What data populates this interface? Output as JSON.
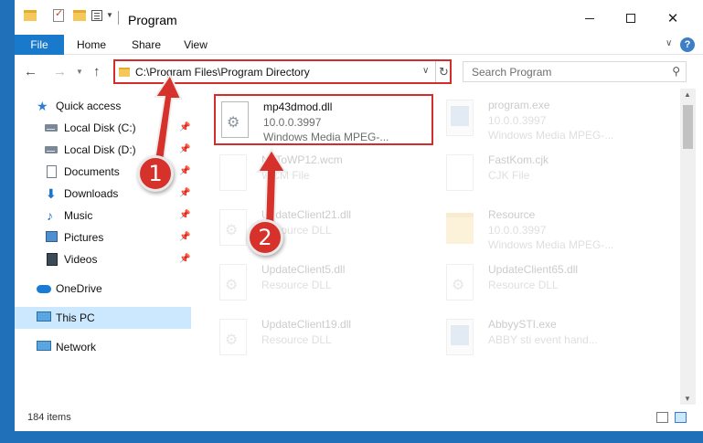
{
  "window": {
    "title": "Program"
  },
  "ribbon": {
    "file": "File",
    "home": "Home",
    "share": "Share",
    "view": "View",
    "help": "?"
  },
  "address": {
    "path": "C:\\Program Files\\Program Directory"
  },
  "search": {
    "placeholder": "Search Program"
  },
  "sidebar": {
    "items": [
      {
        "label": "Quick access",
        "icon": "star-icon",
        "pinned": false
      },
      {
        "label": "Local Disk (C:)",
        "icon": "disk-icon",
        "pinned": true
      },
      {
        "label": "Local Disk (D:)",
        "icon": "disk-icon",
        "pinned": true
      },
      {
        "label": "Documents",
        "icon": "document-icon",
        "pinned": true
      },
      {
        "label": "Downloads",
        "icon": "download-icon",
        "pinned": true
      },
      {
        "label": "Music",
        "icon": "music-icon",
        "pinned": true
      },
      {
        "label": "Pictures",
        "icon": "pictures-icon",
        "pinned": true
      },
      {
        "label": "Videos",
        "icon": "video-icon",
        "pinned": true
      },
      {
        "label": "OneDrive",
        "icon": "cloud-icon",
        "pinned": false
      },
      {
        "label": "This PC",
        "icon": "computer-icon",
        "pinned": false,
        "selected": true
      },
      {
        "label": "Network",
        "icon": "network-icon",
        "pinned": false
      }
    ]
  },
  "files": [
    {
      "name": "mp43dmod.dll",
      "line1": "10.0.0.3997",
      "line2": "Windows Media MPEG-...",
      "icon": "dll-gear-icon",
      "highlighted": true
    },
    {
      "name": "program.exe",
      "line1": "10.0.0.3997",
      "line2": "Windows Media MPEG-...",
      "icon": "exe-icon"
    },
    {
      "name": "NoToWP12.wcm",
      "line1": "WCM File",
      "line2": "",
      "icon": "blank-file-icon"
    },
    {
      "name": "FastKom.cjk",
      "line1": "CJK File",
      "line2": "",
      "icon": "blank-file-icon"
    },
    {
      "name": "UpdateClient21.dll",
      "line1": "Resource DLL",
      "line2": "",
      "icon": "dll-gear-icon"
    },
    {
      "name": "Resource",
      "line1": "10.0.0.3997",
      "line2": "Windows Media MPEG-...",
      "icon": "folder-icon"
    },
    {
      "name": "UpdateClient5.dll",
      "line1": "Resource DLL",
      "line2": "",
      "icon": "dll-gear-icon"
    },
    {
      "name": "UpdateClient65.dll",
      "line1": "Resource DLL",
      "line2": "",
      "icon": "dll-gear-icon"
    },
    {
      "name": "UpdateClient19.dll",
      "line1": "Resource DLL",
      "line2": "",
      "icon": "dll-gear-icon"
    },
    {
      "name": "AbbyySTI.exe",
      "line1": "ABBY sti event hand...",
      "line2": "",
      "icon": "exe-icon"
    }
  ],
  "status": {
    "count": "184 items"
  },
  "annotations": {
    "step1": "1",
    "step2": "2",
    "color": "#d7312c"
  }
}
